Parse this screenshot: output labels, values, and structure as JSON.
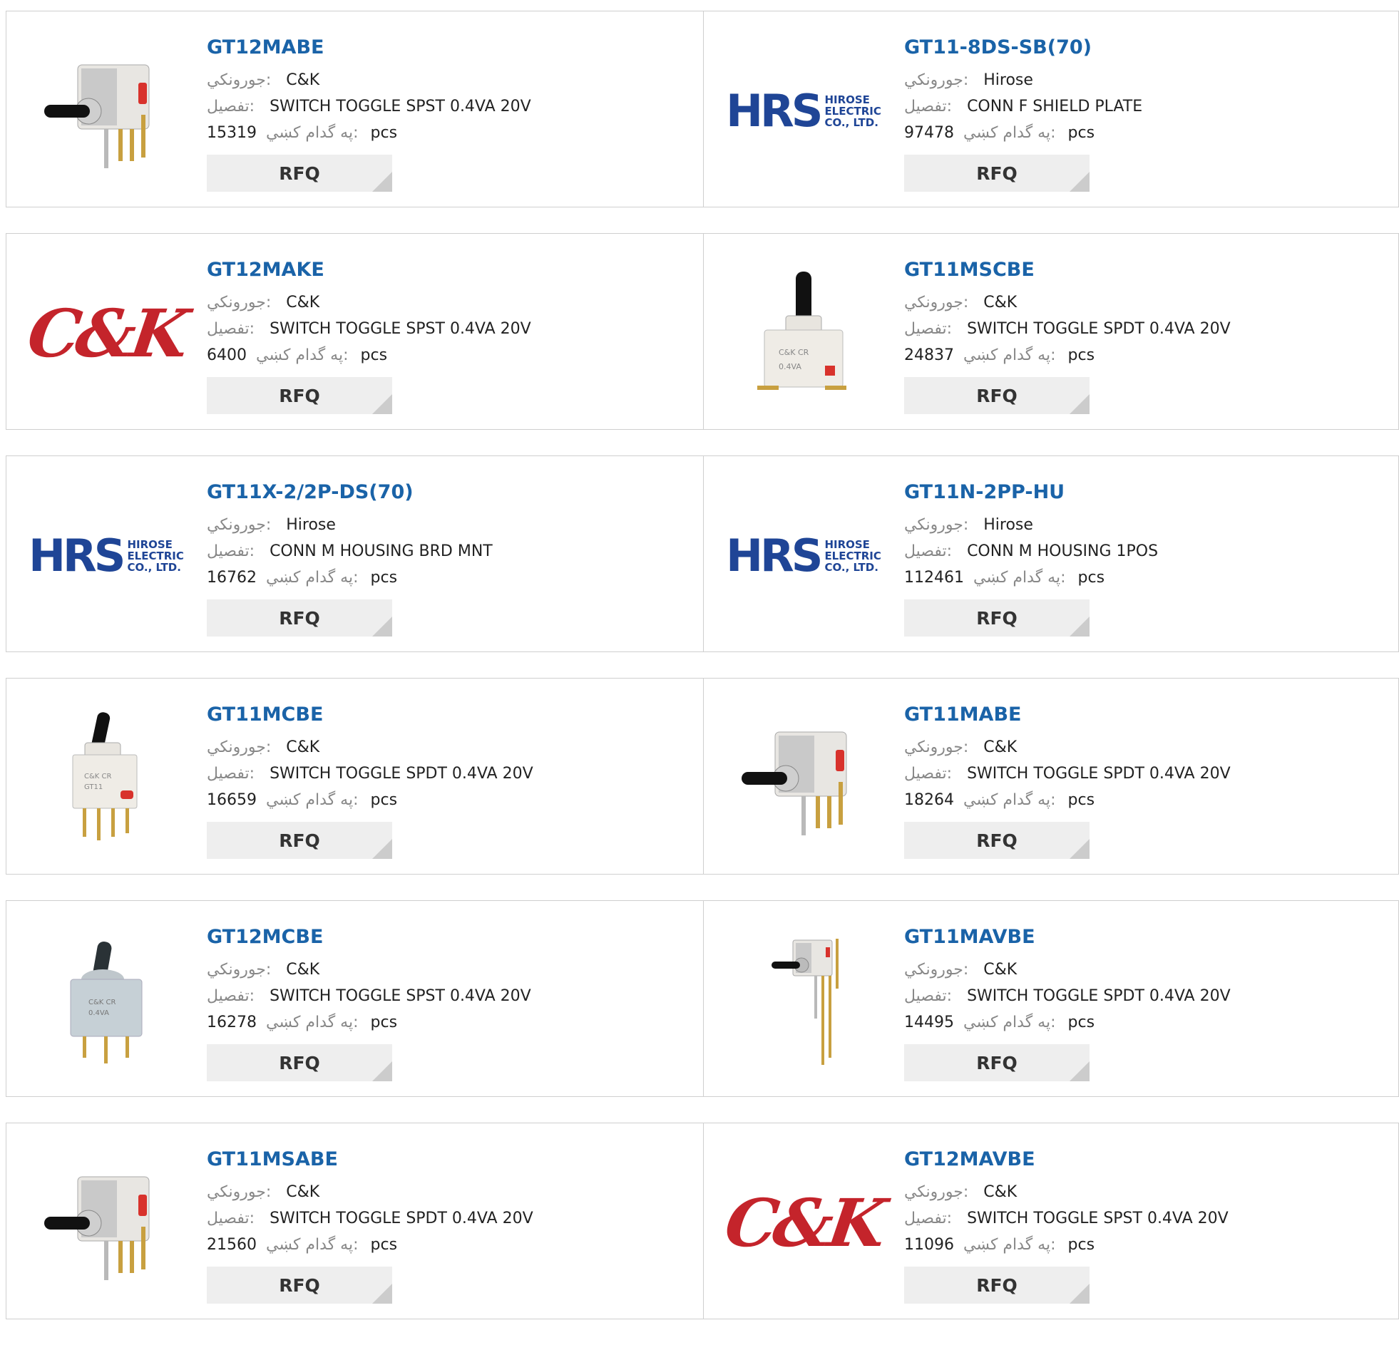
{
  "labels": {
    "manufacturer": "جورونکي:",
    "description": "تفصيل:",
    "stock": "په گدام کښي:",
    "unit": "pcs",
    "button": "RFQ"
  },
  "products": [
    {
      "part": "GT12MABE",
      "mfr": "C&K",
      "desc": "SWITCH TOGGLE SPST 0.4VA 20V",
      "qty": "15319",
      "image": "toggle-switch-right-angle"
    },
    {
      "part": "GT11-8DS-SB(70)",
      "mfr": "Hirose",
      "desc": "CONN F SHIELD PLATE",
      "qty": "97478",
      "image": "hirose-logo"
    },
    {
      "part": "GT12MAKE",
      "mfr": "C&K",
      "desc": "SWITCH TOGGLE SPST 0.4VA 20V",
      "qty": "6400",
      "image": "ck-logo"
    },
    {
      "part": "GT11MSCBE",
      "mfr": "C&K",
      "desc": "SWITCH TOGGLE SPDT 0.4VA 20V",
      "qty": "24837",
      "image": "toggle-switch-smd-vertical"
    },
    {
      "part": "GT11X-2/2P-DS(70)",
      "mfr": "Hirose",
      "desc": "CONN M HOUSING BRD MNT",
      "qty": "16762",
      "image": "hirose-logo"
    },
    {
      "part": "GT11N-2PP-HU",
      "mfr": "Hirose",
      "desc": "CONN M HOUSING 1POS",
      "qty": "112461",
      "image": "hirose-logo"
    },
    {
      "part": "GT11MCBE",
      "mfr": "C&K",
      "desc": "SWITCH TOGGLE SPDT 0.4VA 20V",
      "qty": "16659",
      "image": "toggle-switch-vertical-tht"
    },
    {
      "part": "GT11MABE",
      "mfr": "C&K",
      "desc": "SWITCH TOGGLE SPDT 0.4VA 20V",
      "qty": "18264",
      "image": "toggle-switch-right-angle"
    },
    {
      "part": "GT12MCBE",
      "mfr": "C&K",
      "desc": "SWITCH TOGGLE SPST 0.4VA 20V",
      "qty": "16278",
      "image": "toggle-switch-vertical-grey"
    },
    {
      "part": "GT11MAVBE",
      "mfr": "C&K",
      "desc": "SWITCH TOGGLE SPDT 0.4VA 20V",
      "qty": "14495",
      "image": "toggle-switch-long-pins"
    },
    {
      "part": "GT11MSABE",
      "mfr": "C&K",
      "desc": "SWITCH TOGGLE SPDT 0.4VA 20V",
      "qty": "21560",
      "image": "toggle-switch-right-angle"
    },
    {
      "part": "GT12MAVBE",
      "mfr": "C&K",
      "desc": "SWITCH TOGGLE SPST 0.4VA 20V",
      "qty": "11096",
      "image": "ck-logo"
    }
  ],
  "logos": {
    "hirose_big": "HRS",
    "hirose_small": [
      "HIROSE",
      "ELECTRIC",
      "CO., LTD."
    ],
    "ck": "C&K"
  },
  "colors": {
    "title": "#1a63a8",
    "hirose": "#1f4596",
    "ck": "#c4242b",
    "button_bg": "#eeeeee"
  }
}
